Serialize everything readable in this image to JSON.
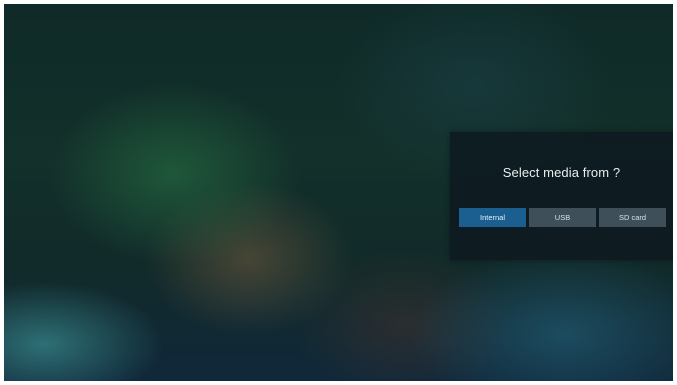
{
  "dialog": {
    "title": "Select media from ?",
    "options": [
      {
        "label": "Internal",
        "selected": true
      },
      {
        "label": "USB",
        "selected": false
      },
      {
        "label": "SD card",
        "selected": false
      }
    ]
  },
  "colors": {
    "selected_button": "#1b5f91",
    "unselected_button": "#3e4f59",
    "dialog_background": "#0e1a20"
  }
}
